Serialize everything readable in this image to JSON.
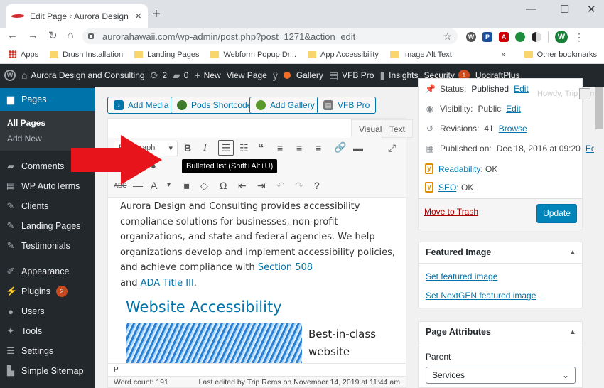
{
  "browser": {
    "tab_title": "Edit Page ‹ Aurora Design and Co",
    "url": "aurorahawaii.com/wp-admin/post.php?post=1271&action=edit",
    "avatar_letter": "W",
    "bookmarks": [
      "Apps",
      "Drush Installation",
      "Landing Pages",
      "Webform Popup Dr...",
      "App Accessibility",
      "Image Alt Text"
    ],
    "bookmarks_more": "»",
    "other_bookmarks": "Other bookmarks"
  },
  "adminbar": {
    "site_name": "Aurora Design and Consulting",
    "updates_count": "2",
    "comments_count": "0",
    "new_label": "New",
    "view_page": "View Page",
    "gallery": "Gallery",
    "vfb_pro": "VFB Pro",
    "insights": "Insights",
    "security": "Security",
    "security_count": "1",
    "updraft": "UpdraftPlus",
    "howdy": "Howdy, Trip Rems"
  },
  "sidebar": {
    "pages": "Pages",
    "all_pages": "All Pages",
    "add_new": "Add New",
    "items": [
      {
        "label": "Comments",
        "icon": "comment-icon"
      },
      {
        "label": "WP AutoTerms",
        "icon": "document-icon"
      },
      {
        "label": "Clients",
        "icon": "pin-icon"
      },
      {
        "label": "Landing Pages",
        "icon": "pin-icon"
      },
      {
        "label": "Testimonials",
        "icon": "pin-icon"
      }
    ],
    "items2": [
      {
        "label": "Appearance",
        "icon": "brush-icon"
      },
      {
        "label": "Plugins",
        "icon": "plug-icon",
        "badge": "2"
      },
      {
        "label": "Users",
        "icon": "user-icon"
      },
      {
        "label": "Tools",
        "icon": "wrench-icon"
      },
      {
        "label": "Settings",
        "icon": "sliders-icon"
      },
      {
        "label": "Simple Sitemap",
        "icon": "sitemap-icon"
      }
    ]
  },
  "editor": {
    "buttons": [
      "Add Media",
      "Pods Shortcode",
      "Add Gallery",
      "VFB Pro"
    ],
    "tab_visual": "Visual",
    "tab_text": "Text",
    "format_select": "Paragraph",
    "tooltip": "Bulleted list (Shift+Alt+U)",
    "para_text": "Aurora Design and Consulting provides accessibility compliance solutions for businesses, non-profit organizations, and state and federal agencies. We help organizations develop and implement accessibility policies, and achieve compliance with ",
    "link1": "Section 508",
    "and": "and ",
    "link2": "ADA Title III",
    "period": ".",
    "heading": "Website Accessibility",
    "side_text": "Best-in-class website",
    "path": "P",
    "word_count": "Word count: 191",
    "last_edited": "Last edited by Trip Rems on November 14, 2019 at 11:44 am"
  },
  "publish": {
    "status_label": "Status:",
    "status_value": "Published",
    "visibility_label": "Visibility:",
    "visibility_value": "Public",
    "revisions_label": "Revisions:",
    "revisions_value": "41",
    "published_label": "Published on:",
    "published_value": "Dec 18, 2016 at 09:20",
    "readability_label": "Readability",
    "readability_value": ": OK",
    "seo_label": "SEO",
    "seo_value": ": OK",
    "edit": "Edit",
    "browse": "Browse",
    "trash": "Move to Trash",
    "update": "Update"
  },
  "featured": {
    "title": "Featured Image",
    "set": "Set featured image",
    "set_nextgen": "Set NextGEN featured image"
  },
  "attributes": {
    "title": "Page Attributes",
    "parent_label": "Parent",
    "parent_value": "Services"
  },
  "colors": {
    "accent": "#0073aa",
    "adminbar": "#23282d",
    "arrow": "#e8141b"
  }
}
